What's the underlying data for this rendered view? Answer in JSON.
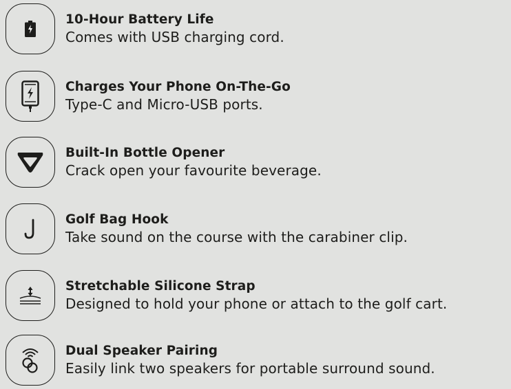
{
  "features": [
    {
      "icon": "battery-icon",
      "title": "10-Hour Battery Life",
      "description": "Comes with USB charging cord."
    },
    {
      "icon": "phone-charging-icon",
      "title": "Charges Your Phone On-The-Go",
      "description": "Type-C and Micro-USB ports."
    },
    {
      "icon": "bottle-opener-icon",
      "title": "Built-In Bottle Opener",
      "description": "Crack open your favourite beverage."
    },
    {
      "icon": "hook-icon",
      "title": "Golf Bag Hook",
      "description": "Take sound on the course with the carabiner clip."
    },
    {
      "icon": "stretch-strap-icon",
      "title": "Stretchable Silicone Strap",
      "description": "Designed to hold your phone or attach to the golf cart."
    },
    {
      "icon": "speaker-pairing-icon",
      "title": "Dual Speaker Pairing",
      "description": "Easily link two speakers for portable surround sound."
    }
  ],
  "colors": {
    "background": "#e1e2e0",
    "text": "#1d1d1b"
  }
}
